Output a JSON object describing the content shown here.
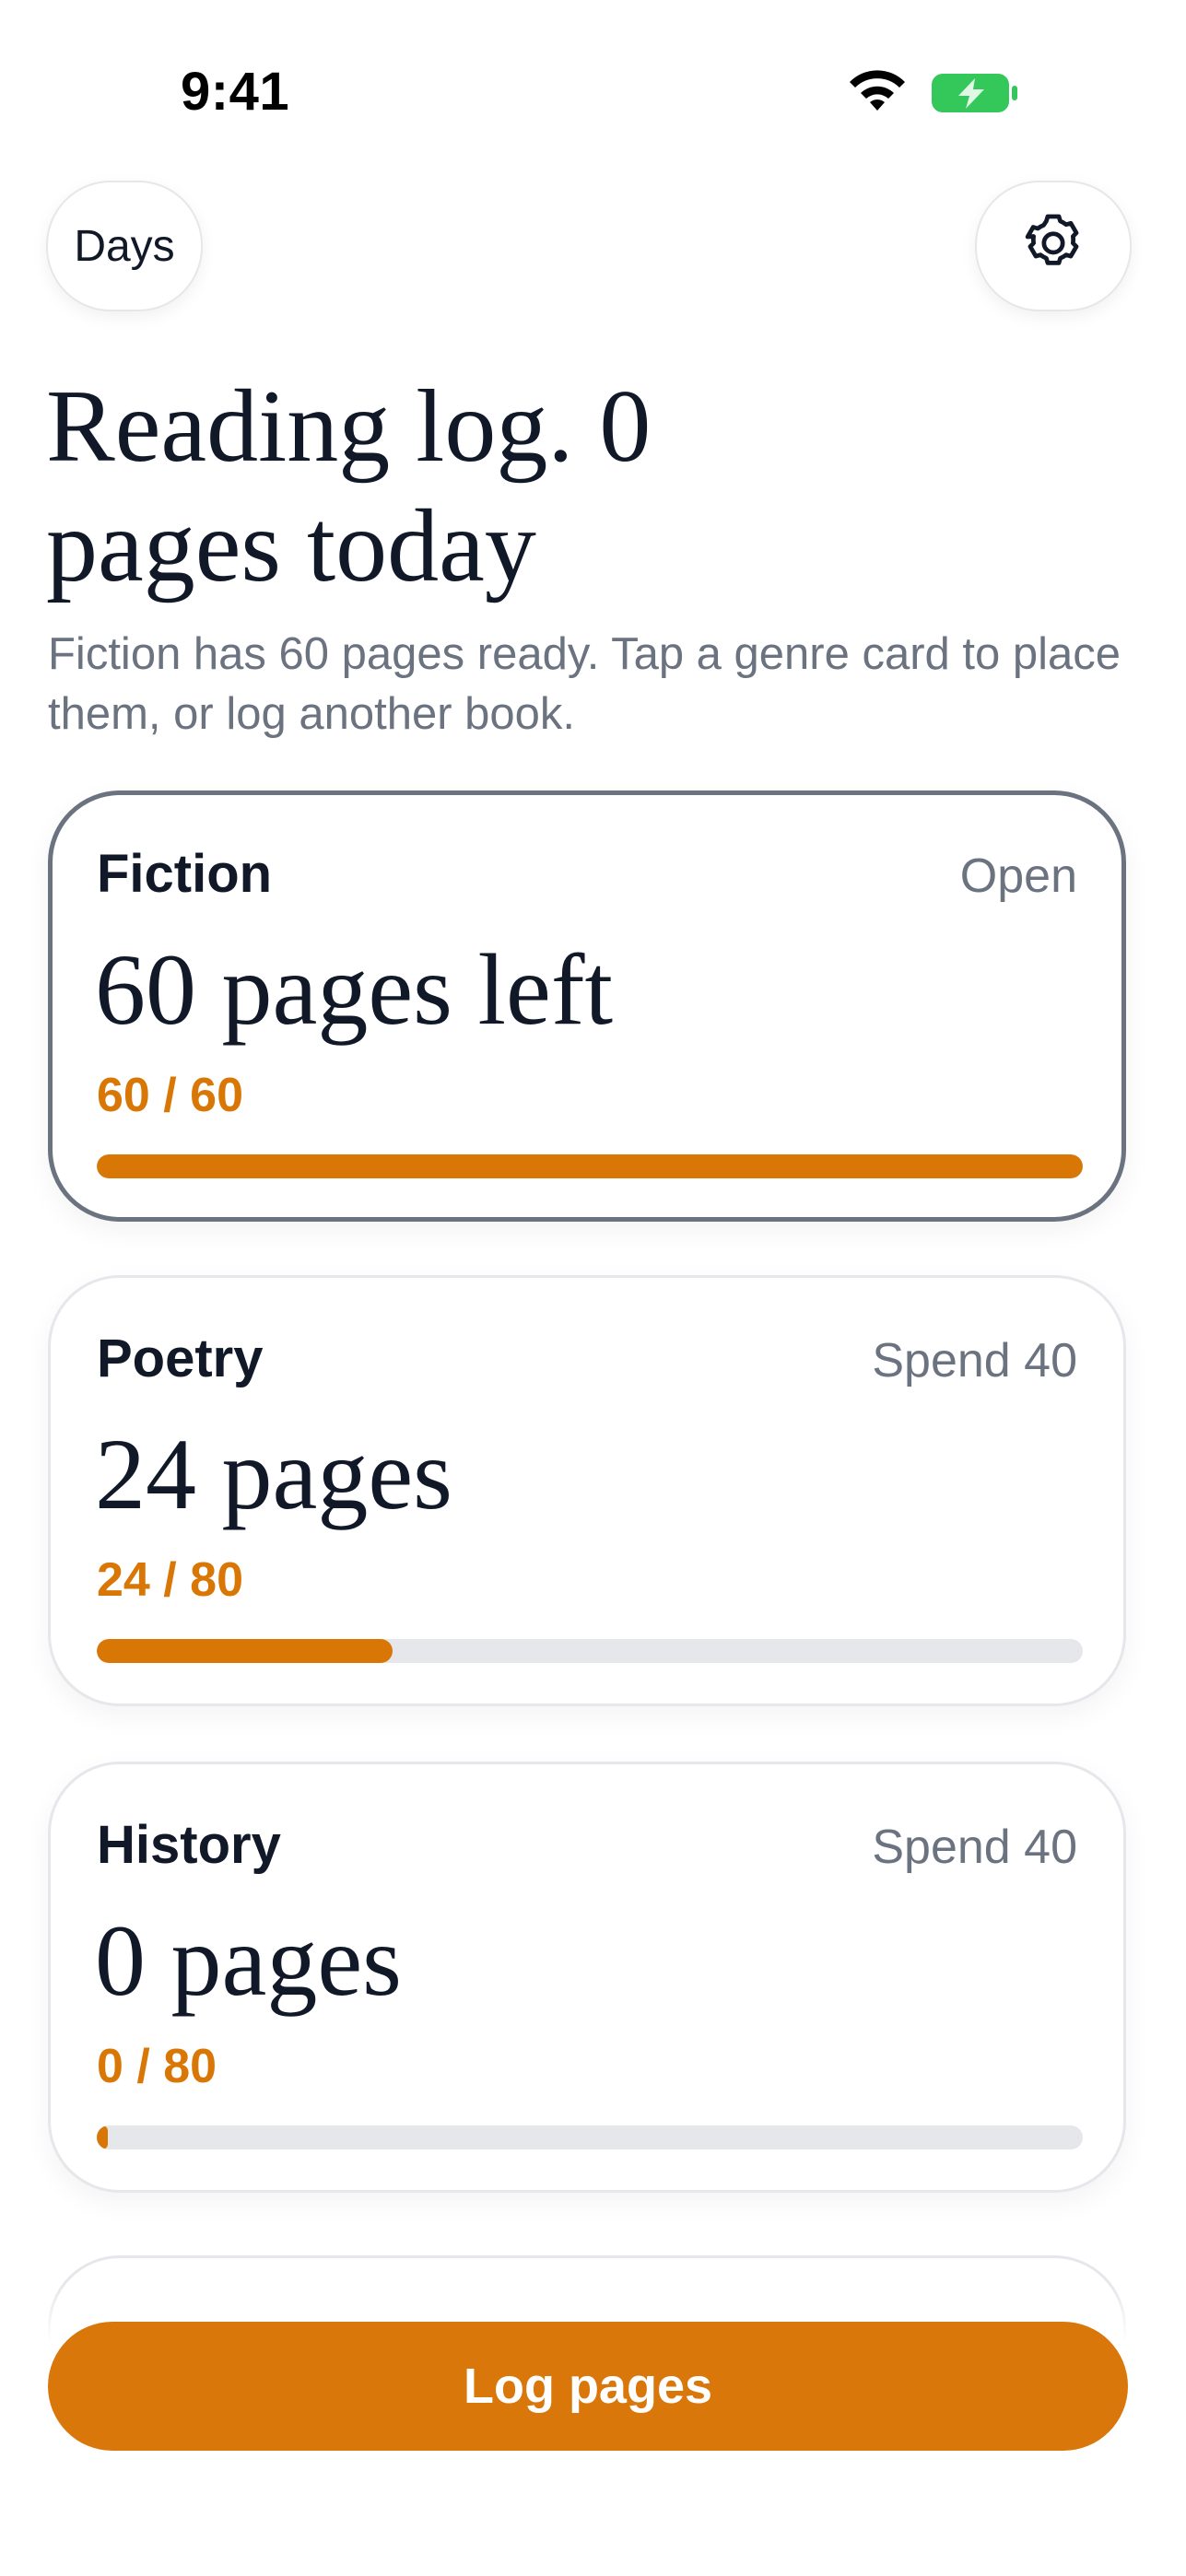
{
  "status_bar": {
    "time": "9:41",
    "wifi_icon": "wifi-icon",
    "battery_icon": "battery-charging-icon",
    "battery_color": "#34c759"
  },
  "header": {
    "days_label": "Days",
    "settings_icon": "gear-icon"
  },
  "title": "Reading log. 0 pages today",
  "subtitle": "Fiction has 60 pages ready. Tap a genre card to place them, or log another book.",
  "accent_color": "#d97706",
  "cards": [
    {
      "name": "Fiction",
      "action": "Open",
      "amount": "60 pages left",
      "progress_text": "60 / 60",
      "progress": 1.0,
      "selected": true
    },
    {
      "name": "Poetry",
      "action": "Spend 40",
      "amount": "24 pages",
      "progress_text": "24 / 80",
      "progress": 0.3,
      "selected": false
    },
    {
      "name": "History",
      "action": "Spend 40",
      "amount": "0 pages",
      "progress_text": "0 / 80",
      "progress": 0.0,
      "selected": false
    }
  ],
  "primary_button": {
    "label": "Log pages"
  }
}
